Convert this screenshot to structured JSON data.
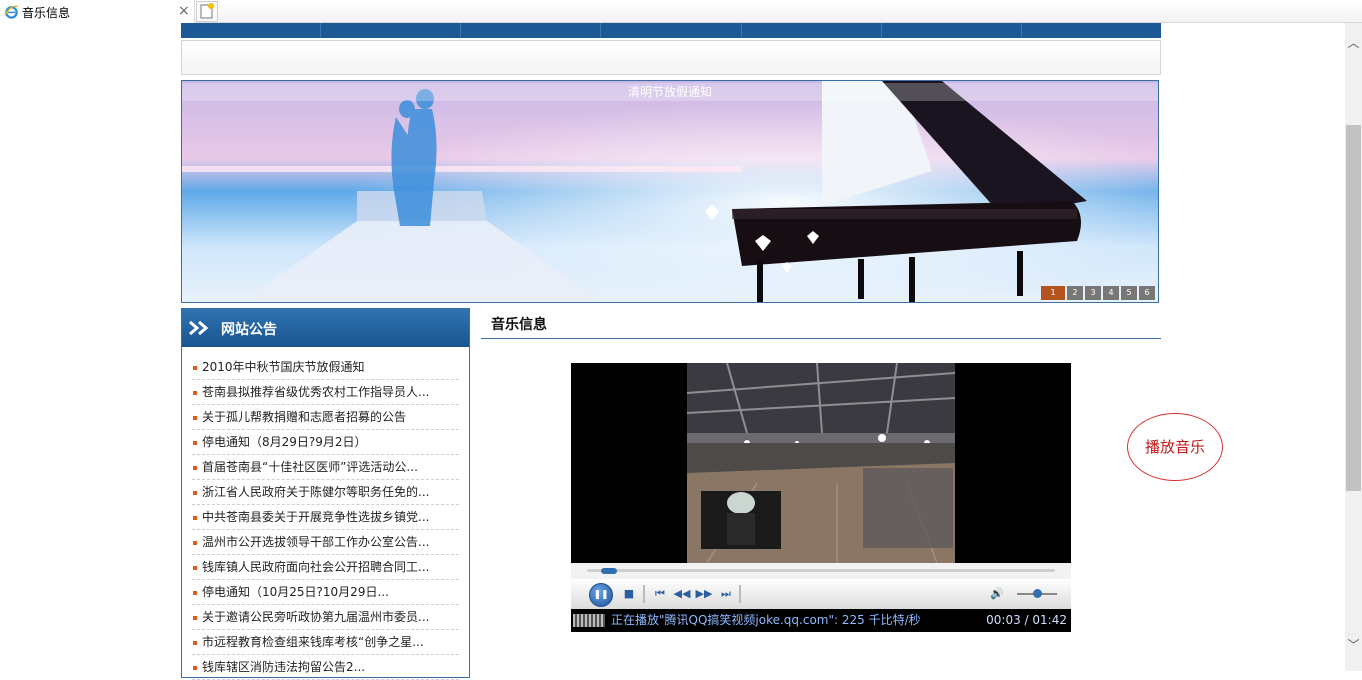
{
  "browser": {
    "tab_title": "音乐信息",
    "close_glyph": "×"
  },
  "banner": {
    "caption": "清明节放假通知",
    "pages": [
      "1",
      "2",
      "3",
      "4",
      "5",
      "6"
    ],
    "active_page": "1"
  },
  "notice": {
    "title": "网站公告",
    "items": [
      "2010年中秋节国庆节放假通知",
      "苍南县拟推荐省级优秀农村工作指导员人...",
      "关于孤儿帮教捐赠和志愿者招募的公告",
      "停电通知（8月29日?9月2日）",
      "首届苍南县“十佳社区医师”评选活动公...",
      "浙江省人民政府关于陈健尔等职务任免的...",
      "中共苍南县委关于开展竞争性选拔乡镇党...",
      "温州市公开选拔领导干部工作办公室公告...",
      "钱库镇人民政府面向社会公开招聘合同工...",
      "停电通知（10月25日?10月29日...",
      "关于邀请公民旁听政协第九届温州市委员...",
      "市远程教育检查组来钱库考核“创争之星...",
      "钱库辖区消防违法拘留公告2..."
    ]
  },
  "music": {
    "title": "音乐信息",
    "player": {
      "status_text": "正在播放\"腾讯QQ搞笑视频joke.qq.com\": 225 千比特/秒",
      "time": "00:03 / 01:42",
      "seek_progress": 0.03,
      "volume_level": 0.5
    },
    "play_music_label": "播放音乐"
  },
  "colors": {
    "nav_blue": "#1b5a96",
    "accent_orange": "#e05a1a",
    "play_music_red": "#d93030"
  }
}
